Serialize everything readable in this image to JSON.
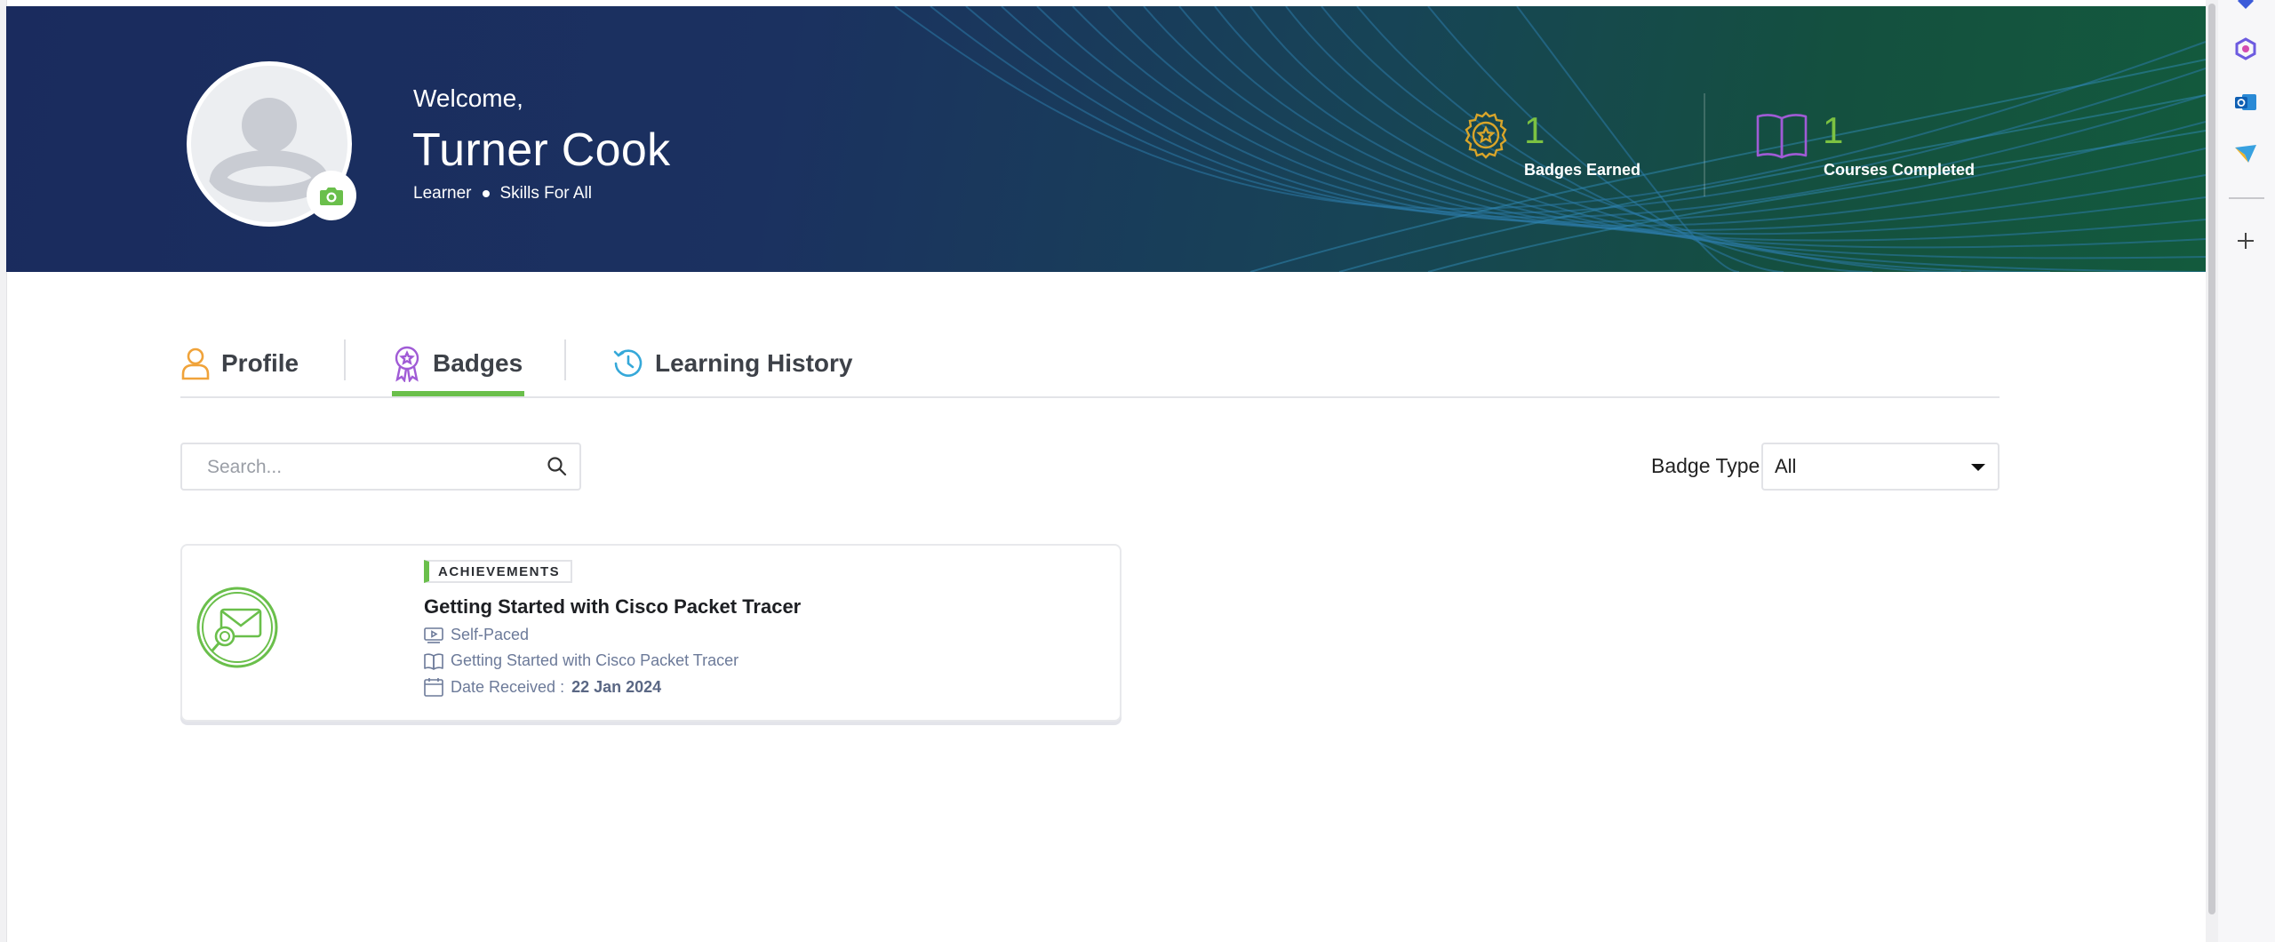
{
  "header": {
    "welcome": "Welcome,",
    "name": "Turner Cook",
    "role": "Learner",
    "organization": "Skills For All"
  },
  "stats": {
    "badges_value": "1",
    "badges_label": "Badges Earned",
    "courses_value": "1",
    "courses_label": "Courses Completed"
  },
  "tabs": [
    {
      "label": "Profile"
    },
    {
      "label": "Badges"
    },
    {
      "label": "Learning History"
    }
  ],
  "filters": {
    "search_placeholder": "Search...",
    "badge_type_label": "Badge Type",
    "badge_type_value": "All"
  },
  "badge_card": {
    "tag": "ACHIEVEMENTS",
    "title": "Getting Started with Cisco Packet Tracer",
    "mode": "Self-Paced",
    "course": "Getting Started with Cisco Packet Tracer",
    "date_label": "Date Received :",
    "date_value": "22 Jan 2024"
  },
  "colors": {
    "accent_green": "#6abf4b",
    "stat_green": "#7cc242",
    "banner_navy": "#1a2b5e",
    "banner_teal": "#135a3d"
  }
}
